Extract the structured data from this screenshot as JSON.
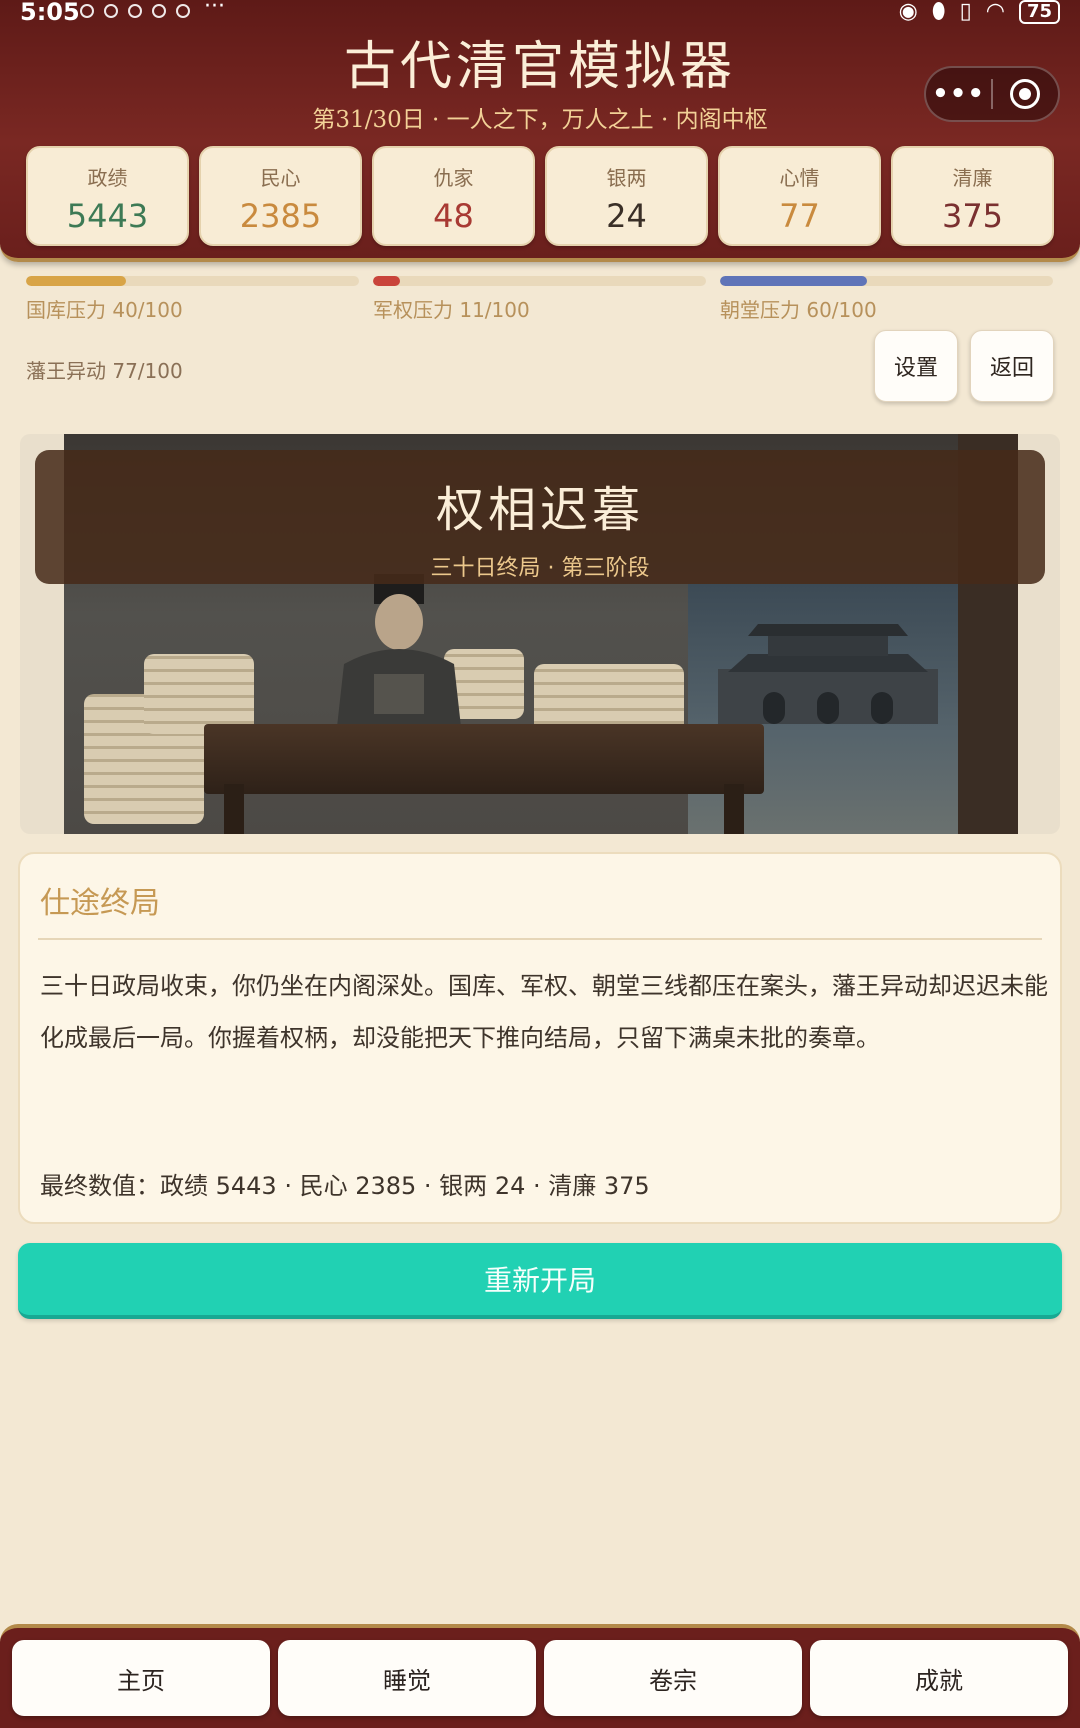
{
  "status_bar": {
    "time": "5:05",
    "more": "···",
    "battery": "75"
  },
  "app": {
    "title": "古代清官模拟器",
    "subtitle": "第31/30日 · 一人之下，万人之上 · 内阁中枢"
  },
  "capsule": {
    "more_label": "•••"
  },
  "stats": [
    {
      "label": "政绩",
      "value": "5443",
      "color": "#3d7a55"
    },
    {
      "label": "民心",
      "value": "2385",
      "color": "#c98a3e"
    },
    {
      "label": "仇家",
      "value": "48",
      "color": "#a83a33"
    },
    {
      "label": "银两",
      "value": "24",
      "color": "#3a2f27"
    },
    {
      "label": "心情",
      "value": "77",
      "color": "#c98a3e"
    },
    {
      "label": "清廉",
      "value": "375",
      "color": "#7a3030"
    }
  ],
  "pressures": [
    {
      "label": "国库压力 40/100",
      "level": 0.3,
      "color": "#d8a447"
    },
    {
      "label": "军权压力 11/100",
      "level": 0.08,
      "color": "#c9443b"
    },
    {
      "label": "朝堂压力 60/100",
      "level": 0.44,
      "color": "#5f74b8"
    }
  ],
  "fan_unrest": "藩王异动 77/100",
  "buttons": {
    "settings": "设置",
    "back": "返回",
    "restart": "重新开局"
  },
  "hero": {
    "title": "权相迟暮",
    "subtitle": "三十日终局 · 第三阶段"
  },
  "result": {
    "title": "仕途终局",
    "body": "三十日政局收束，你仍坐在内阁深处。国库、军权、朝堂三线都压在案头，藩王异动却迟迟未能化成最后一局。你握着权柄，却没能把天下推向结局，只留下满桌未批的奏章。",
    "final": "最终数值：政绩 5443 · 民心 2385 · 银两 24 · 清廉 375"
  },
  "nav": [
    {
      "label": "主页"
    },
    {
      "label": "睡觉"
    },
    {
      "label": "卷宗"
    },
    {
      "label": "成就"
    }
  ]
}
